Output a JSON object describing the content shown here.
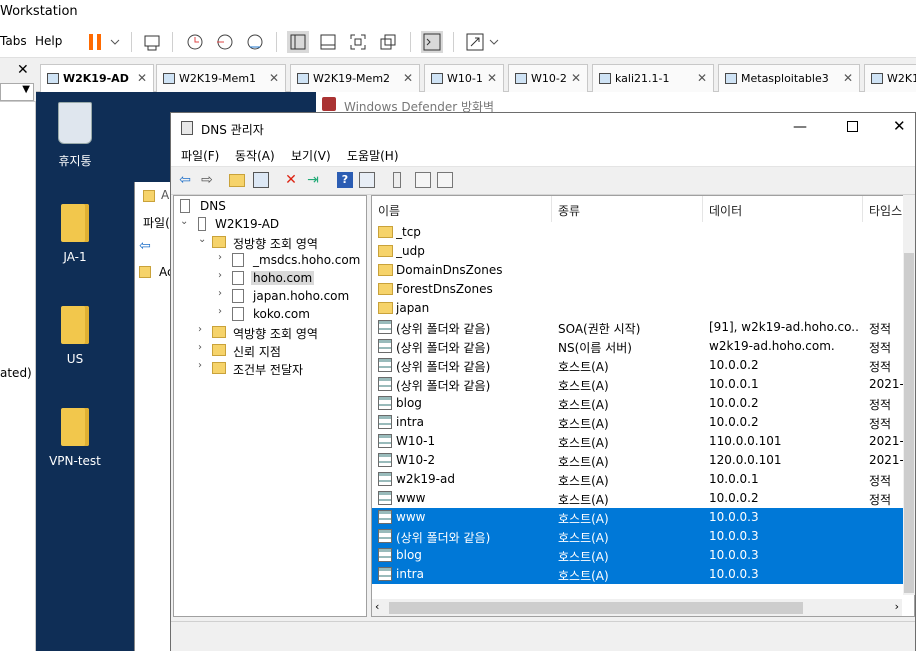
{
  "vmware": {
    "title": "Workstation",
    "menu": [
      "Tabs",
      "Help"
    ],
    "left_panel_status": "ated)"
  },
  "tabs": [
    {
      "label": "W2K19-AD",
      "active": true
    },
    {
      "label": "W2K19-Mem1"
    },
    {
      "label": "W2K19-Mem2"
    },
    {
      "label": "W10-1"
    },
    {
      "label": "W10-2"
    },
    {
      "label": "kali21.1-1"
    },
    {
      "label": "Metasploitable3"
    },
    {
      "label": "W2K1"
    }
  ],
  "desktop": {
    "icons": [
      {
        "label": "휴지통",
        "kind": "recycle-bin-icon"
      },
      {
        "label": "JA-1",
        "kind": "folder-icon"
      },
      {
        "label": "US",
        "kind": "folder-icon"
      },
      {
        "label": "VPN-test",
        "kind": "folder-icon"
      }
    ],
    "bg_window_title": "Windows Defender 방화벽",
    "bg_explorer_menu": "파일(",
    "bg_explorer_item1": "A",
    "bg_explorer_item2": "Ac"
  },
  "dns": {
    "title": "DNS 관리자",
    "menu": [
      "파일(F)",
      "동작(A)",
      "보기(V)",
      "도움말(H)"
    ],
    "tree": {
      "root": "DNS",
      "server": "W2K19-AD",
      "forward": "정방향 조회 영역",
      "zones": [
        "_msdcs.hoho.com",
        "hoho.com",
        "japan.hoho.com",
        "koko.com"
      ],
      "reverse": "역방향 조회 영역",
      "trust": "신뢰 지점",
      "forwarders": "조건부 전달자"
    },
    "columns": [
      "이름",
      "종류",
      "데이터",
      "타임스"
    ],
    "rows": [
      {
        "name": "_tcp",
        "type": "",
        "data": "",
        "ts": "",
        "icon": "folder"
      },
      {
        "name": "_udp",
        "type": "",
        "data": "",
        "ts": "",
        "icon": "folder"
      },
      {
        "name": "DomainDnsZones",
        "type": "",
        "data": "",
        "ts": "",
        "icon": "folder"
      },
      {
        "name": "ForestDnsZones",
        "type": "",
        "data": "",
        "ts": "",
        "icon": "folder"
      },
      {
        "name": "japan",
        "type": "",
        "data": "",
        "ts": "",
        "icon": "folder"
      },
      {
        "name": "(상위 폴더와 같음)",
        "type": "SOA(권한 시작)",
        "data": "[91], w2k19-ad.hoho.co...",
        "ts": "정적",
        "icon": "record"
      },
      {
        "name": "(상위 폴더와 같음)",
        "type": "NS(이름 서버)",
        "data": "w2k19-ad.hoho.com.",
        "ts": "정적",
        "icon": "record"
      },
      {
        "name": "(상위 폴더와 같음)",
        "type": "호스트(A)",
        "data": "10.0.0.2",
        "ts": "정적",
        "icon": "record"
      },
      {
        "name": "(상위 폴더와 같음)",
        "type": "호스트(A)",
        "data": "10.0.0.1",
        "ts": "2021-0",
        "icon": "record"
      },
      {
        "name": "blog",
        "type": "호스트(A)",
        "data": "10.0.0.2",
        "ts": "정적",
        "icon": "record"
      },
      {
        "name": "intra",
        "type": "호스트(A)",
        "data": "10.0.0.2",
        "ts": "정적",
        "icon": "record"
      },
      {
        "name": "W10-1",
        "type": "호스트(A)",
        "data": "110.0.0.101",
        "ts": "2021-0",
        "icon": "record"
      },
      {
        "name": "W10-2",
        "type": "호스트(A)",
        "data": "120.0.0.101",
        "ts": "2021-0",
        "icon": "record"
      },
      {
        "name": "w2k19-ad",
        "type": "호스트(A)",
        "data": "10.0.0.1",
        "ts": "정적",
        "icon": "record"
      },
      {
        "name": "www",
        "type": "호스트(A)",
        "data": "10.0.0.2",
        "ts": "정적",
        "icon": "record"
      },
      {
        "name": "www",
        "type": "호스트(A)",
        "data": "10.0.0.3",
        "ts": "",
        "icon": "record",
        "selected": true
      },
      {
        "name": "(상위 폴더와 같음)",
        "type": "호스트(A)",
        "data": "10.0.0.3",
        "ts": "",
        "icon": "record",
        "selected": true
      },
      {
        "name": "blog",
        "type": "호스트(A)",
        "data": "10.0.0.3",
        "ts": "",
        "icon": "record",
        "selected": true
      },
      {
        "name": "intra",
        "type": "호스트(A)",
        "data": "10.0.0.3",
        "ts": "",
        "icon": "record",
        "selected": true
      }
    ]
  },
  "colors": {
    "selection": "#0078d7",
    "desktop": "#0f2e56",
    "folder": "#f6d36a"
  }
}
